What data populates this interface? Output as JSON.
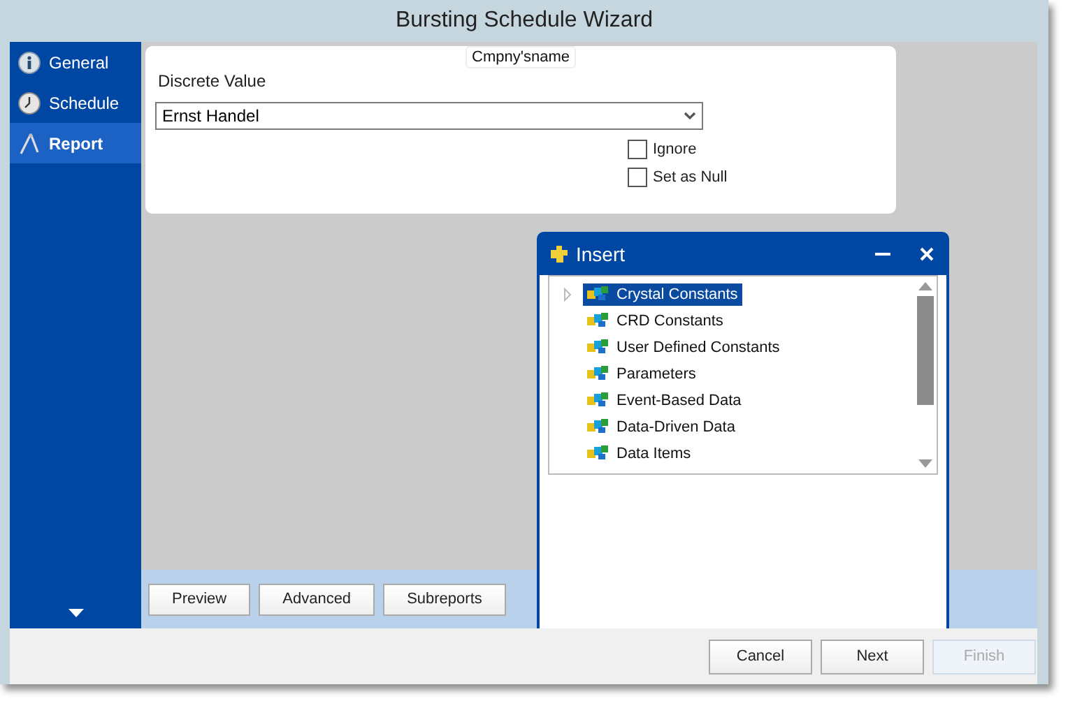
{
  "window": {
    "title": "Bursting Schedule Wizard"
  },
  "sidebar": {
    "items": [
      {
        "label": "General",
        "kind": "info",
        "selected": false
      },
      {
        "label": "Schedule",
        "kind": "clock",
        "selected": false
      },
      {
        "label": "Report",
        "kind": "compass",
        "selected": true
      }
    ]
  },
  "parameter_panel": {
    "title": "Cmpny'sname",
    "field_label": "Discrete Value",
    "value": "Ernst Handel",
    "options": [
      {
        "label": "Ignore",
        "checked": false
      },
      {
        "label": "Set as Null",
        "checked": false
      }
    ]
  },
  "report_buttons": [
    "Preview",
    "Advanced",
    "Subreports"
  ],
  "insert_dialog": {
    "title": "Insert",
    "items": [
      {
        "label": "Crystal Constants",
        "selected": true
      },
      {
        "label": "CRD Constants",
        "selected": false
      },
      {
        "label": "User Defined Constants",
        "selected": false
      },
      {
        "label": "Parameters",
        "selected": false
      },
      {
        "label": "Event-Based Data",
        "selected": false
      },
      {
        "label": "Data-Driven Data",
        "selected": false
      },
      {
        "label": "Data Items",
        "selected": false
      }
    ]
  },
  "footer_buttons": [
    {
      "label": "Cancel",
      "disabled": false
    },
    {
      "label": "Next",
      "disabled": false
    },
    {
      "label": "Finish",
      "disabled": true
    }
  ]
}
